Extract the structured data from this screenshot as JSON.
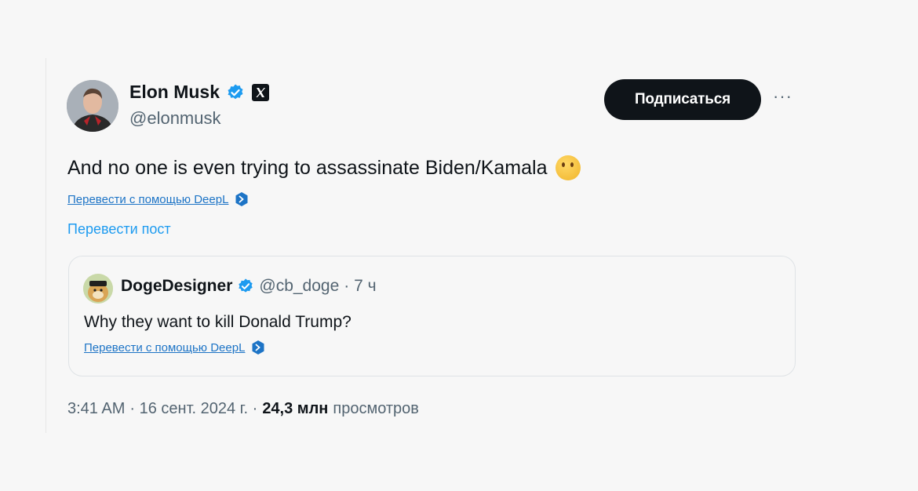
{
  "author": {
    "name": "Elon Musk",
    "handle": "@elonmusk",
    "verified_icon": "verified-badge-icon",
    "affiliate_icon": "x-logo-icon"
  },
  "actions": {
    "follow_label": "Подписаться",
    "more_label": "···"
  },
  "tweet": {
    "text": "And no one is even trying to assassinate Biden/Kamala",
    "emoji": "thinking-face-icon",
    "deepl_label": "Перевести с помощью DeepL",
    "translate_post_label": "Перевести пост"
  },
  "quote": {
    "name": "DogeDesigner",
    "handle": "@cb_doge",
    "time": "· 7 ч",
    "text": "Why they want to kill Donald Trump?",
    "deepl_label": "Перевести с помощью DeepL"
  },
  "footer": {
    "time": "3:41 AM",
    "date": "· 16 сент. 2024 г. ·",
    "views_count": "24,3 млн",
    "views_label": "просмотров"
  },
  "colors": {
    "accent": "#1d9bf0",
    "button_bg": "#0f1419",
    "text_muted": "#536471"
  }
}
